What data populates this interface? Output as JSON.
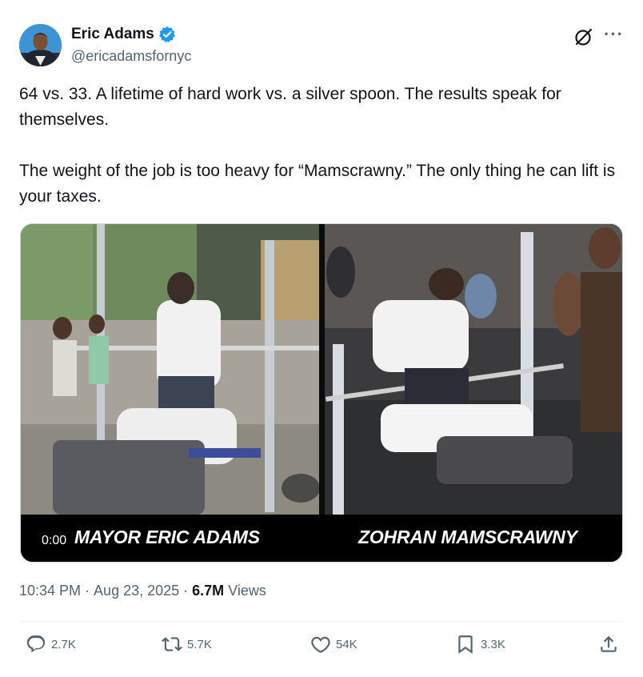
{
  "author": {
    "name": "Eric Adams",
    "handle": "@ericadamsfornyc",
    "verified": true,
    "verified_color": "#1d9bf0"
  },
  "icons": {
    "grok": "grok-icon",
    "more": "more-icon",
    "reply": "reply-icon",
    "retweet": "retweet-icon",
    "like": "heart-icon",
    "bookmark": "bookmark-icon",
    "share": "share-icon"
  },
  "more_glyph": "···",
  "tweet": {
    "paragraph1": "64 vs. 33. A lifetime of hard work vs. a silver spoon. The results speak for themselves.",
    "paragraph2": "The weight of the job is too heavy for “Mamscrawny.” The only thing he can lift is your taxes."
  },
  "media": {
    "time": "0:00",
    "caption_left": "MAYOR ERIC ADAMS",
    "caption_right": "ZOHRAN MAMSCRAWNY"
  },
  "meta": {
    "time": "10:34 PM",
    "dot1": "·",
    "date": "Aug 23, 2025",
    "dot2": "·",
    "views_count": "6.7M",
    "views_label": "Views"
  },
  "actions": {
    "replies": "2.7K",
    "reposts": "5.7K",
    "likes": "54K",
    "bookmarks": "3.3K"
  },
  "colors": {
    "text_primary": "#0f1419",
    "text_secondary": "#536471",
    "accent": "#1d9bf0"
  }
}
